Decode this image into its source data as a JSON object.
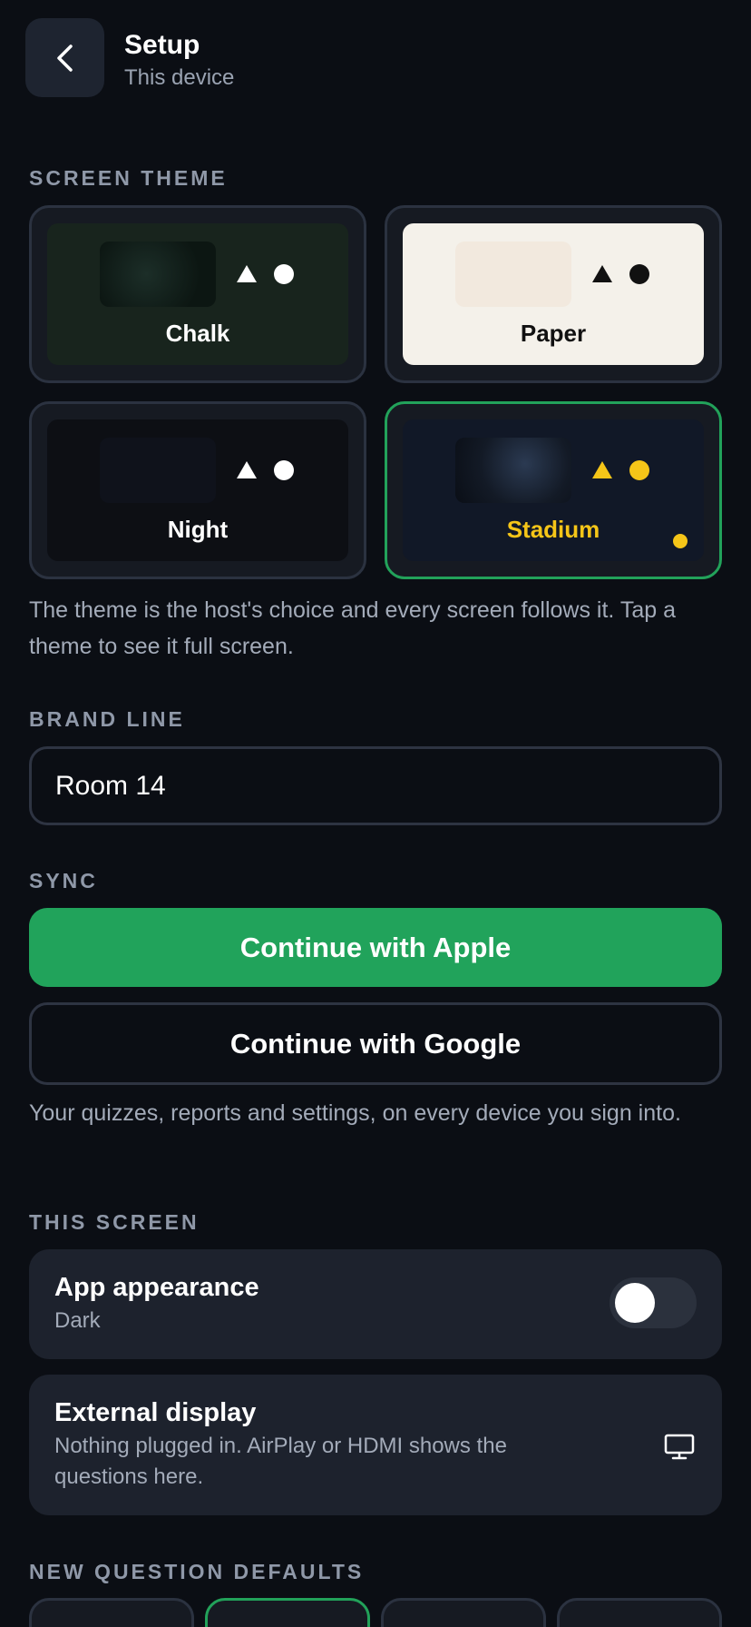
{
  "header": {
    "title": "Setup",
    "subtitle": "This device",
    "back_icon": "chevron-left-icon"
  },
  "screen_theme": {
    "label": "SCREEN THEME",
    "themes": [
      {
        "name": "Chalk",
        "selected": false,
        "bg": "#18241d",
        "name_color": "#ffffff",
        "shape_color": "#ffffff"
      },
      {
        "name": "Paper",
        "selected": false,
        "bg": "#f4f1ea",
        "name_color": "#111111",
        "shape_color": "#111111"
      },
      {
        "name": "Night",
        "selected": false,
        "bg": "#0d0f14",
        "name_color": "#ffffff",
        "shape_color": "#ffffff"
      },
      {
        "name": "Stadium",
        "selected": true,
        "bg": "#111827",
        "name_color": "#f5c518",
        "shape_color": "#f5c518"
      }
    ],
    "help": "The theme is the host's choice and every screen follows it. Tap a theme to see it full screen."
  },
  "brand_line": {
    "label": "BRAND LINE",
    "value": "Room 14"
  },
  "sync": {
    "label": "SYNC",
    "apple_button": "Continue with Apple",
    "google_button": "Continue with Google",
    "help": "Your quizzes, reports and settings, on every device you sign into."
  },
  "this_screen": {
    "label": "THIS SCREEN",
    "appearance": {
      "title": "App appearance",
      "value": "Dark",
      "toggle_on": false
    },
    "external_display": {
      "title": "External display",
      "description": "Nothing plugged in. AirPlay or HDMI shows the questions here.",
      "icon": "monitor-icon"
    }
  },
  "new_question_defaults": {
    "label": "NEW QUESTION DEFAULTS"
  },
  "colors": {
    "accent": "#22a25a",
    "stadium_yellow": "#f5c518"
  }
}
